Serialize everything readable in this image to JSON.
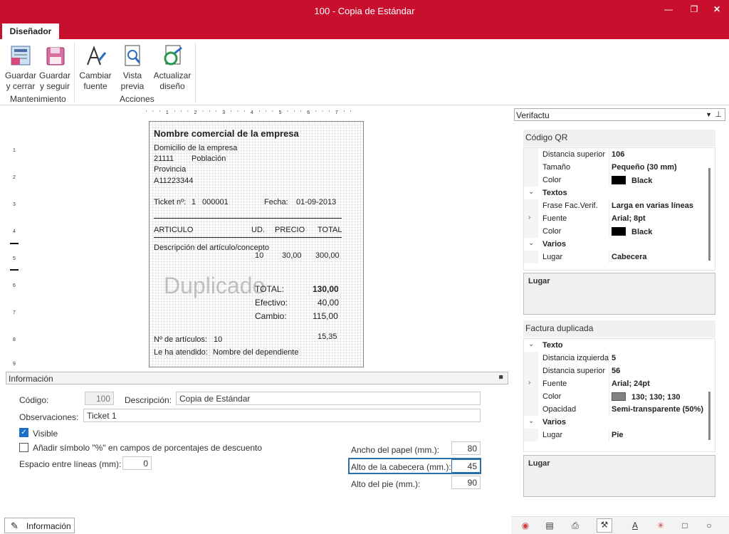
{
  "window": {
    "title": "100 - Copia de Estándar"
  },
  "ribbon": {
    "tab": "Diseñador",
    "buttons": {
      "guardar_cerrar": [
        "Guardar",
        "y cerrar"
      ],
      "guardar_seguir": [
        "Guardar",
        "y seguir"
      ],
      "cambiar_fuente": [
        "Cambiar",
        "fuente"
      ],
      "vista_previa": [
        "Vista",
        "previa"
      ],
      "actualizar": [
        "Actualizar",
        "diseño"
      ]
    },
    "groups": {
      "mantenimiento": "Mantenimiento",
      "acciones": "Acciones"
    }
  },
  "ruler": {
    "top": "' ' ' 1 ' ' ' 2 ' ' ' 3 ' ' ' 4 ' ' ' 5 ' ' ' 6 ' ' ' 7 ' '",
    "left": [
      "1",
      "2",
      "3",
      "4",
      "5",
      "6",
      "7",
      "8",
      "9"
    ]
  },
  "ticket": {
    "company": "Nombre  comercial de la empresa",
    "address": "Domicilio de la empresa",
    "postal": "21111",
    "city": "Población",
    "province": "Provincia",
    "nif": "A11223344",
    "ticket_label": "Ticket nº:",
    "ticket_serie": "1",
    "ticket_num": "000001",
    "date_label": "Fecha:",
    "date": "01-09-2013",
    "col_art": "ARTICULO",
    "col_ud": "UD.",
    "col_precio": "PRECIO",
    "col_total": "TOTAL",
    "item_desc": "Descripción del artículo/concepto",
    "item_ud": "10",
    "item_precio": "30,00",
    "item_total": "300,00",
    "watermark": "Duplicado",
    "total_label": "TOTAL:",
    "total": "130,00",
    "efectivo_label": "Efectivo:",
    "efectivo": "40,00",
    "cambio_label": "Cambio:",
    "cambio": "115,00",
    "narticulos_label": "Nº de artículos:",
    "narticulos": "10",
    "extra": "15,35",
    "atendido_label": "Le ha atendido:",
    "atendido": "Nombre del dependiente"
  },
  "info": {
    "header": "Información",
    "codigo_label": "Código:",
    "codigo": "100",
    "descripcion_label": "Descripción:",
    "descripcion": "Copia de Estándar",
    "observaciones_label": "Observaciones:",
    "observaciones": "Ticket 1",
    "visible_label": "Visible",
    "visible_checked": true,
    "simbolo_label": "Añadir símbolo \"%\" en campos de porcentajes de descuento",
    "simbolo_checked": false,
    "espacio_label": "Espacio entre líneas (mm):",
    "espacio": "0",
    "ancho_label": "Ancho del papel (mm.):",
    "ancho": "80",
    "alto_cab_label": "Alto de la cabecera (mm.):",
    "alto_cab": "45",
    "alto_pie_label": "Alto del pie (mm.):",
    "alto_pie": "90",
    "bottom_tab": "Información"
  },
  "props": {
    "combo": "Verifactu",
    "qr": {
      "title": "Código QR",
      "rows": [
        {
          "k": "Distancia superior",
          "v": "106"
        },
        {
          "k": "Tamaño",
          "v": "Pequeño (30 mm)"
        },
        {
          "k": "Color",
          "v": "Black",
          "swatch": "#000000"
        },
        {
          "cat": "Textos"
        },
        {
          "k": "Frase Fac.Verif.",
          "v": "Larga en varias líneas"
        },
        {
          "k": "Fuente",
          "v": "Arial; 8pt",
          "expand": true
        },
        {
          "k": "Color",
          "v": "Black",
          "swatch": "#000000"
        },
        {
          "cat": "Varios"
        },
        {
          "k": "Lugar",
          "v": "Cabecera"
        }
      ],
      "desc": "Lugar"
    },
    "dup": {
      "title": "Factura duplicada",
      "rows": [
        {
          "cat": "Texto"
        },
        {
          "k": "Distancia izquierda",
          "v": "5"
        },
        {
          "k": "Distancia superior",
          "v": "56"
        },
        {
          "k": "Fuente",
          "v": "Arial; 24pt",
          "expand": true
        },
        {
          "k": "Color",
          "v": "130; 130; 130",
          "swatch": "#828282"
        },
        {
          "k": "Opacidad",
          "v": "Semi-transparente (50%)"
        },
        {
          "cat": "Varios"
        },
        {
          "k": "Lugar",
          "v": "Pie"
        }
      ],
      "desc": "Lugar"
    }
  },
  "colors": {
    "accent": "#c8102e",
    "check": "#1e6fc8"
  }
}
